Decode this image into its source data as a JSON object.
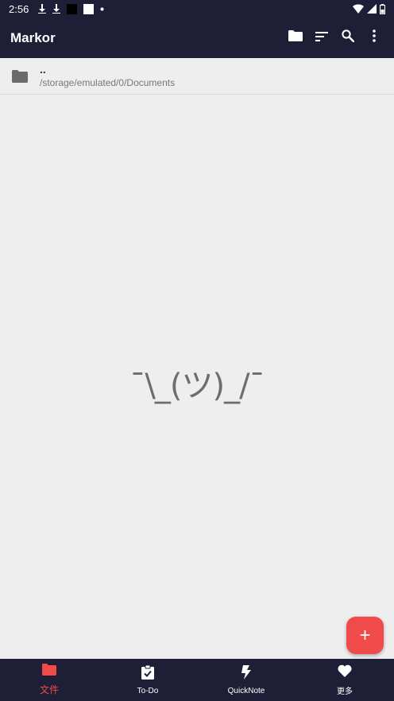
{
  "status_bar": {
    "time": "2:56",
    "icons": [
      "download-icon",
      "download-icon",
      "black-square-icon",
      "white-square-icon",
      "dot-icon"
    ],
    "right_icons": [
      "wifi-icon",
      "signal-icon",
      "battery-icon"
    ]
  },
  "app_bar": {
    "title": "Markor",
    "actions": [
      "folder-icon",
      "sort-icon",
      "search-icon",
      "more-vert-icon"
    ]
  },
  "folder_row": {
    "name": "..",
    "path": "/storage/emulated/0/Documents"
  },
  "empty_state": {
    "art": "¯\\_(ツ)_/¯"
  },
  "fab": {
    "label": "+"
  },
  "bottom_nav": {
    "items": [
      {
        "label": "文件",
        "icon": "folder-icon"
      },
      {
        "label": "To-Do",
        "icon": "clipboard-check-icon"
      },
      {
        "label": "QuickNote",
        "icon": "bolt-icon"
      },
      {
        "label": "更多",
        "icon": "heart-icon"
      }
    ],
    "active_index": 0
  },
  "colors": {
    "bar_bg": "#1e1f36",
    "accent": "#f04a4a",
    "page_bg": "#eeeeee"
  }
}
